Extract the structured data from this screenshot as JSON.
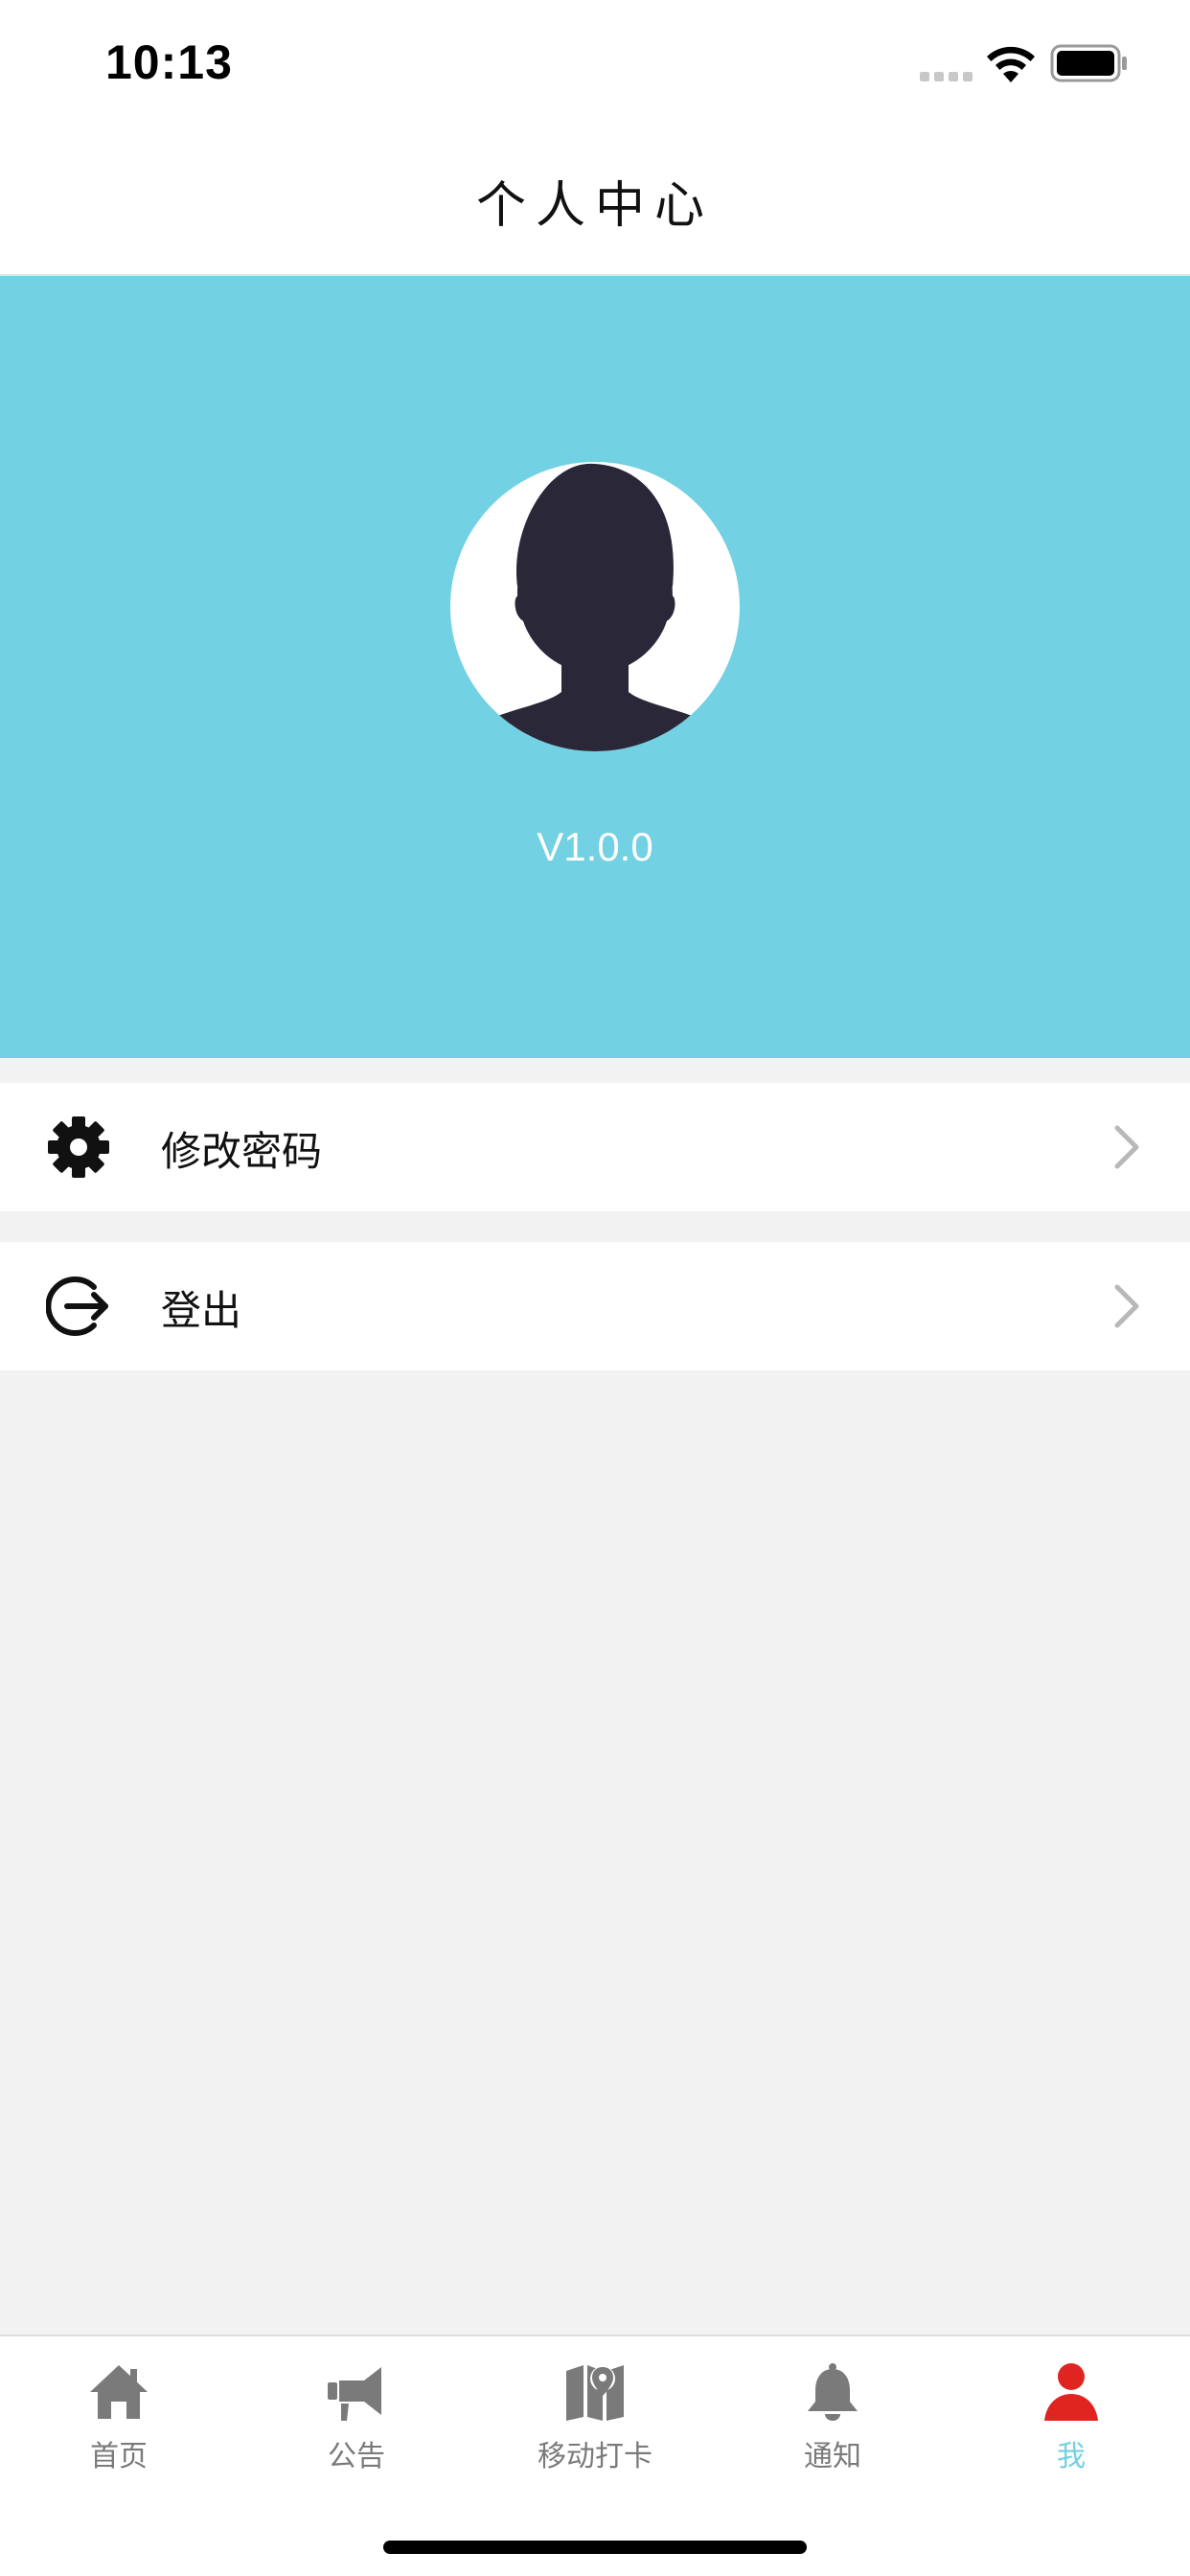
{
  "status_bar": {
    "time": "10:13"
  },
  "nav": {
    "title": "个人中心"
  },
  "profile": {
    "version": "V1.0.0"
  },
  "menu": [
    {
      "label": "修改密码",
      "icon": "gear-icon"
    },
    {
      "label": "登出",
      "icon": "logout-icon"
    }
  ],
  "tabs": [
    {
      "label": "首页",
      "icon": "home-icon",
      "active": false
    },
    {
      "label": "公告",
      "icon": "megaphone-icon",
      "active": false
    },
    {
      "label": "移动打卡",
      "icon": "map-pin-icon",
      "active": false
    },
    {
      "label": "通知",
      "icon": "bell-icon",
      "active": false
    },
    {
      "label": "我",
      "icon": "person-icon",
      "active": true
    }
  ],
  "colors": {
    "header_bg": "#72d1e2",
    "active_tab_label": "#72d1e2",
    "active_tab_icon": "#e02420",
    "inactive_tab": "#7a7a7a",
    "avatar_silhouette": "#2a2838"
  }
}
